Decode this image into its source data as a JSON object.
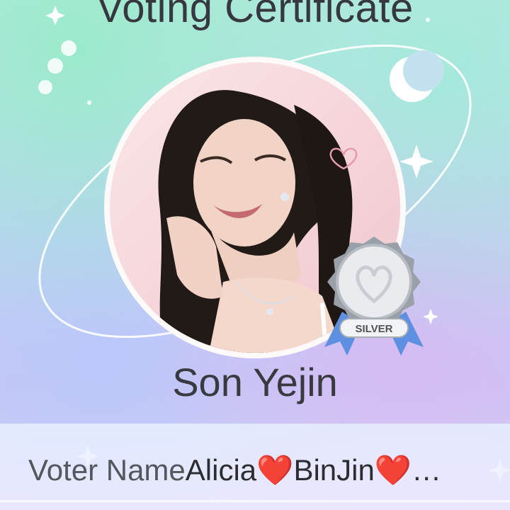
{
  "certificate": {
    "title": "Voting Certificate",
    "idol_name": "Son Yejin",
    "badge_label": "SILVER",
    "voter_label": "Voter Name",
    "voter_value": "Alicia❤️BinJin❤️…"
  },
  "colors": {
    "text": "#37383f",
    "badge_silver": "#c9cdd3",
    "ribbon_blue": "#5f8fe0"
  },
  "icons": [
    "crescent-moon-icon",
    "sparkle-star-icon",
    "heart-icon",
    "silver-medal-icon"
  ]
}
